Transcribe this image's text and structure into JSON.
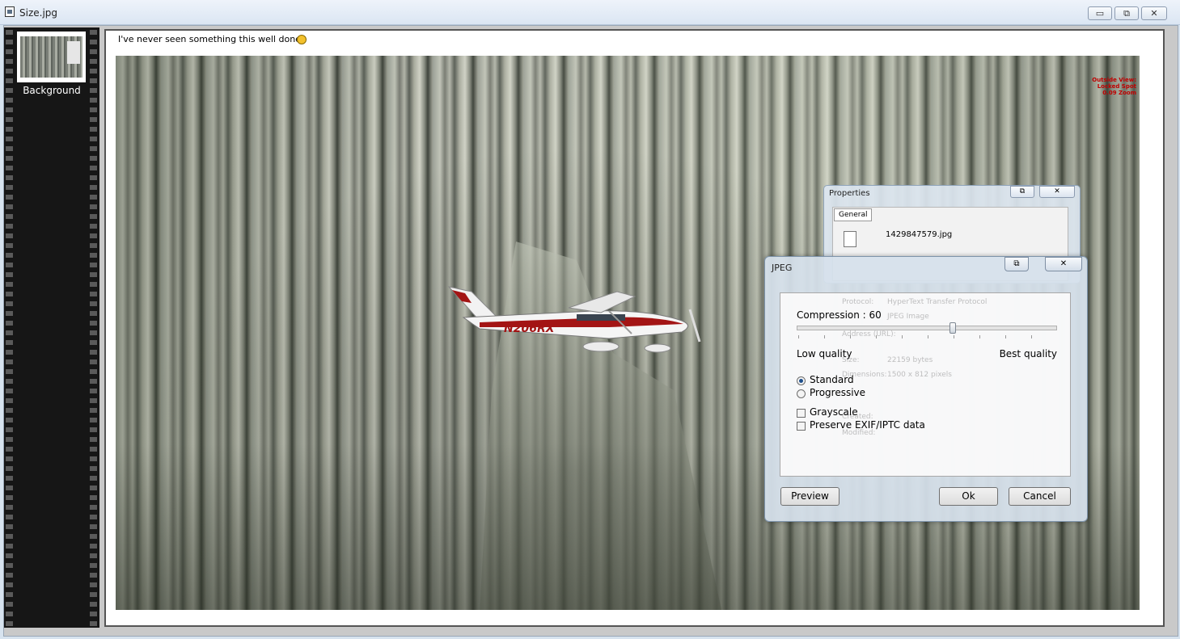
{
  "window": {
    "title": "Size.jpg",
    "controls": {
      "minimize": "▭",
      "maximize": "⧉",
      "close": "✕"
    }
  },
  "filmstrip": {
    "layers": [
      {
        "label": "Background"
      }
    ]
  },
  "canvas": {
    "caption": "I've never seen something this well done!",
    "photo": {
      "aircraft_registration": "N206RX",
      "hud_lines": [
        "Outside View:",
        "Locked Spot",
        "0.09 Zoom"
      ]
    }
  },
  "properties_dialog": {
    "title": "Properties",
    "tab": "General",
    "file_name": "1429847579.jpg",
    "background_rows": [
      "Protocol:",
      "HyperText Transfer Protocol",
      "JPEG Image",
      "Address (URL):",
      "Size:",
      "22159 bytes",
      "Dimensions:",
      "1500 x 812 pixels",
      "Created:",
      "Modified:"
    ]
  },
  "jpeg_dialog": {
    "title": "JPEG",
    "compression_label": "Compression : 60",
    "compression_value": 60,
    "compression_range": [
      0,
      100
    ],
    "low_label": "Low quality",
    "best_label": "Best quality",
    "encoding_options": [
      {
        "label": "Standard",
        "selected": true
      },
      {
        "label": "Progressive",
        "selected": false
      }
    ],
    "checkboxes": [
      {
        "label": "Grayscale",
        "checked": false
      },
      {
        "label": "Preserve EXIF/IPTC data",
        "checked": false
      }
    ],
    "buttons": {
      "preview": "Preview",
      "ok": "Ok",
      "cancel": "Cancel"
    }
  },
  "colors": {
    "aircraft_stripe": "#a31515",
    "hud_text": "#c00000",
    "dialog_glass": "#d6e1ec"
  }
}
